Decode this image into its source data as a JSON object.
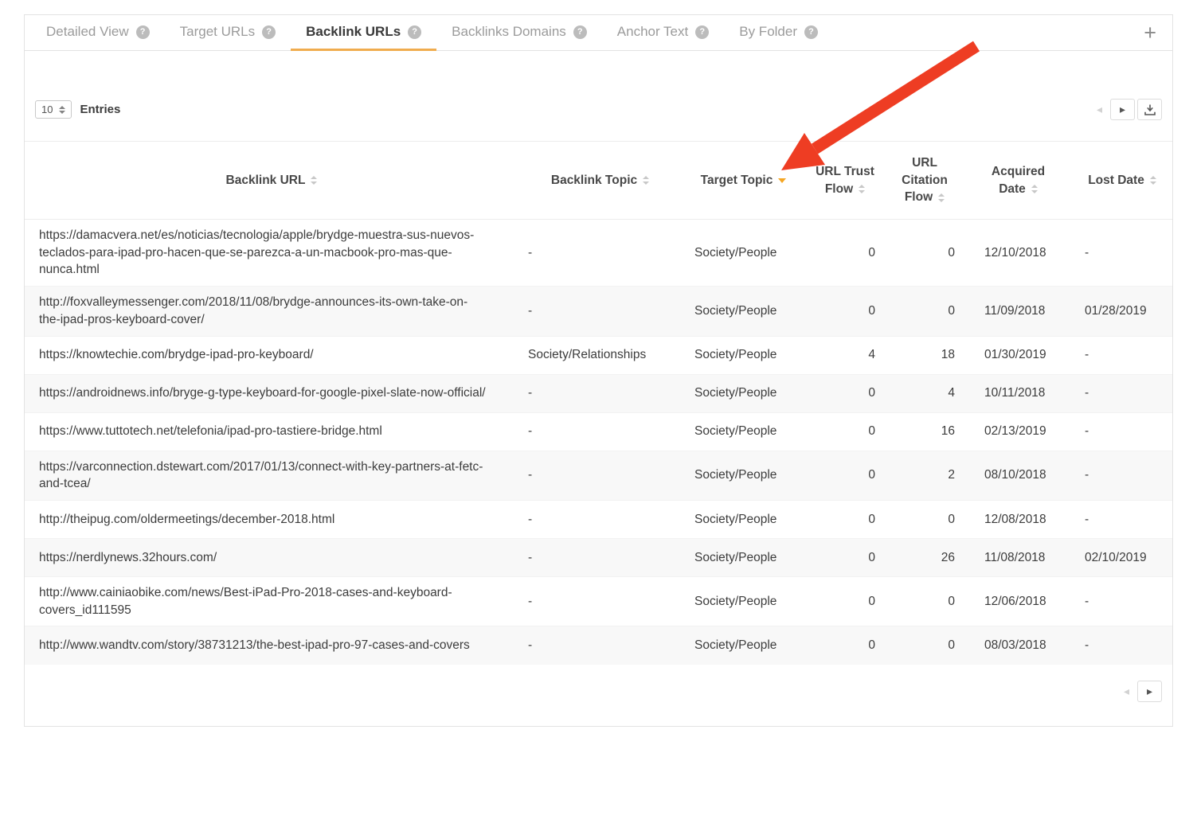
{
  "tabs": [
    {
      "label": "Detailed View"
    },
    {
      "label": "Target URLs"
    },
    {
      "label": "Backlink URLs"
    },
    {
      "label": "Backlinks Domains"
    },
    {
      "label": "Anchor Text"
    },
    {
      "label": "By Folder"
    }
  ],
  "active_tab": "Backlink URLs",
  "icons": {
    "help": "?",
    "plus": "+",
    "prev_arrow": "◂",
    "next_arrow": "▸"
  },
  "toolbar": {
    "entries_value": "10",
    "entries_label": "Entries"
  },
  "table": {
    "headers": {
      "backlink_url": "Backlink URL",
      "backlink_topic": "Backlink Topic",
      "target_topic": "Target Topic",
      "trust_flow": "URL Trust Flow",
      "citation_flow": "URL Citation Flow",
      "acquired_date": "Acquired Date",
      "lost_date": "Lost Date"
    },
    "sorted_column": "Target Topic",
    "sort_direction": "desc",
    "rows": [
      {
        "backlink_url": "https://damacvera.net/es/noticias/tecnologia/apple/brydge-muestra-sus-nuevos-teclados-para-ipad-pro-hacen-que-se-parezca-a-un-macbook-pro-mas-que-nunca.html",
        "backlink_topic": "-",
        "target_topic": "Society/People",
        "trust_flow": 0,
        "citation_flow": 0,
        "acquired_date": "12/10/2018",
        "lost_date": "-"
      },
      {
        "backlink_url": "http://foxvalleymessenger.com/2018/11/08/brydge-announces-its-own-take-on-the-ipad-pros-keyboard-cover/",
        "backlink_topic": "-",
        "target_topic": "Society/People",
        "trust_flow": 0,
        "citation_flow": 0,
        "acquired_date": "11/09/2018",
        "lost_date": "01/28/2019"
      },
      {
        "backlink_url": "https://knowtechie.com/brydge-ipad-pro-keyboard/",
        "backlink_topic": "Society/Relationships",
        "target_topic": "Society/People",
        "trust_flow": 4,
        "citation_flow": 18,
        "acquired_date": "01/30/2019",
        "lost_date": "-"
      },
      {
        "backlink_url": "https://androidnews.info/bryge-g-type-keyboard-for-google-pixel-slate-now-official/",
        "backlink_topic": "-",
        "target_topic": "Society/People",
        "trust_flow": 0,
        "citation_flow": 4,
        "acquired_date": "10/11/2018",
        "lost_date": "-"
      },
      {
        "backlink_url": "https://www.tuttotech.net/telefonia/ipad-pro-tastiere-bridge.html",
        "backlink_topic": "-",
        "target_topic": "Society/People",
        "trust_flow": 0,
        "citation_flow": 16,
        "acquired_date": "02/13/2019",
        "lost_date": "-"
      },
      {
        "backlink_url": "https://varconnection.dstewart.com/2017/01/13/connect-with-key-partners-at-fetc-and-tcea/",
        "backlink_topic": "-",
        "target_topic": "Society/People",
        "trust_flow": 0,
        "citation_flow": 2,
        "acquired_date": "08/10/2018",
        "lost_date": "-"
      },
      {
        "backlink_url": "http://theipug.com/oldermeetings/december-2018.html",
        "backlink_topic": "-",
        "target_topic": "Society/People",
        "trust_flow": 0,
        "citation_flow": 0,
        "acquired_date": "12/08/2018",
        "lost_date": "-"
      },
      {
        "backlink_url": "https://nerdlynews.32hours.com/",
        "backlink_topic": "-",
        "target_topic": "Society/People",
        "trust_flow": 0,
        "citation_flow": 26,
        "acquired_date": "11/08/2018",
        "lost_date": "02/10/2019"
      },
      {
        "backlink_url": "http://www.cainiaobike.com/news/Best-iPad-Pro-2018-cases-and-keyboard-covers_id111595",
        "backlink_topic": "-",
        "target_topic": "Society/People",
        "trust_flow": 0,
        "citation_flow": 0,
        "acquired_date": "12/06/2018",
        "lost_date": "-"
      },
      {
        "backlink_url": "http://www.wandtv.com/story/38731213/the-best-ipad-pro-97-cases-and-covers",
        "backlink_topic": "-",
        "target_topic": "Society/People",
        "trust_flow": 0,
        "citation_flow": 0,
        "acquired_date": "08/03/2018",
        "lost_date": "-"
      }
    ]
  },
  "colors": {
    "accent_orange": "#f0ac4e",
    "caret_orange": "#f5a623",
    "arrow_red": "#ee3d23"
  }
}
